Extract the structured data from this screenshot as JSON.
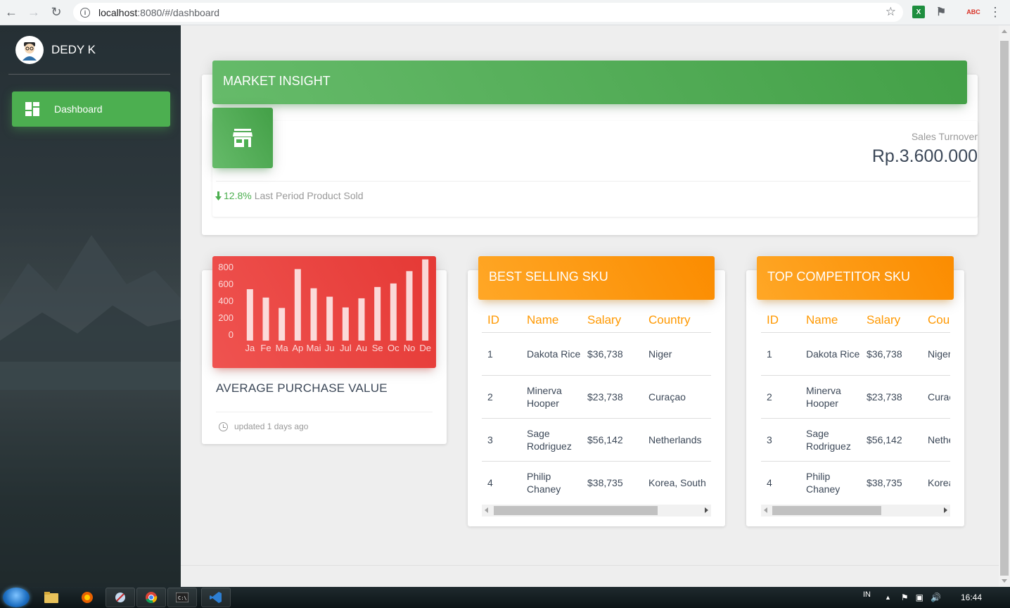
{
  "browser": {
    "url_host": "localhost",
    "url_path": ":8080/#/dashboard"
  },
  "sidebar": {
    "user_name": "DEDY K",
    "items": [
      {
        "label": "Dashboard",
        "icon": "dashboard-icon",
        "active": true
      }
    ]
  },
  "market_insight": {
    "title": "MARKET INSIGHT",
    "icon": "store-icon",
    "category": "Sales Turnover",
    "value": "Rp.3.600.000",
    "stat_change": "12.8%",
    "stat_text": "Last Period Product Sold"
  },
  "chart_card": {
    "title": "AVERAGE PURCHASE VALUE",
    "footer": "updated 1 days ago"
  },
  "chart_data": {
    "type": "bar",
    "categories": [
      "Ja",
      "Fe",
      "Ma",
      "Ap",
      "Mai",
      "Ju",
      "Jul",
      "Au",
      "Se",
      "Oc",
      "No",
      "De"
    ],
    "values": [
      542,
      443,
      320,
      780,
      553,
      453,
      326,
      434,
      568,
      610,
      756,
      895
    ],
    "yticks": [
      0,
      200,
      400,
      600,
      800
    ],
    "ylim": [
      0,
      800
    ],
    "color": "rgba(255,255,255,0.8)"
  },
  "best_selling": {
    "title": "BEST SELLING SKU",
    "columns": [
      "ID",
      "Name",
      "Salary",
      "Country"
    ],
    "rows": [
      {
        "id": "1",
        "name": "Dakota Rice",
        "salary": "$36,738",
        "country": "Niger"
      },
      {
        "id": "2",
        "name": "Minerva Hooper",
        "salary": "$23,738",
        "country": "Curaçao"
      },
      {
        "id": "3",
        "name": "Sage Rodriguez",
        "salary": "$56,142",
        "country": "Netherlands"
      },
      {
        "id": "4",
        "name": "Philip Chaney",
        "salary": "$38,735",
        "country": "Korea, South"
      }
    ]
  },
  "top_competitor": {
    "title": "TOP COMPETITOR SKU",
    "columns": [
      "ID",
      "Name",
      "Salary",
      "Country"
    ],
    "rows": [
      {
        "id": "1",
        "name": "Dakota Rice",
        "salary": "$36,738",
        "country": "Niger"
      },
      {
        "id": "2",
        "name": "Minerva Hooper",
        "salary": "$23,738",
        "country": "Curaçao"
      },
      {
        "id": "3",
        "name": "Sage Rodriguez",
        "salary": "$56,142",
        "country": "Netherlands"
      },
      {
        "id": "4",
        "name": "Philip Chaney",
        "salary": "$38,735",
        "country": "Korea, South"
      }
    ]
  },
  "taskbar": {
    "language": "IN",
    "time": "16:44"
  },
  "colors": {
    "green": "#4caf50",
    "orange": "#ff9800",
    "red": "#e53935"
  }
}
